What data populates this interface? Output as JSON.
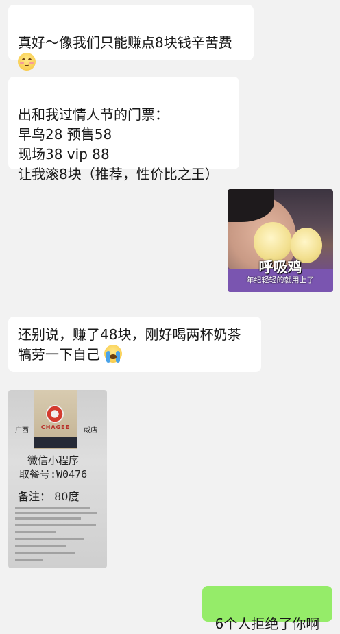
{
  "messages": [
    {
      "sender": "other",
      "type": "text",
      "text": "真好～像我们只能赚点8块钱辛苦费",
      "emoji": "smiling-face-icon"
    },
    {
      "sender": "other",
      "type": "text",
      "text": "出和我过情人节的门票：\n早鸟28  预售58\n现场38 vip 88\n让我滚8块（推荐，性价比之王）"
    },
    {
      "sender": "me",
      "type": "image",
      "meme_title": "呼吸鸡",
      "meme_subtitle": "年纪轻轻的就用上了"
    },
    {
      "sender": "other",
      "type": "text",
      "text_line1": "还别说，赚了48块，刚好喝两杯奶茶",
      "text_line2": "犒劳一下自己",
      "emoji": "crying-face-icon"
    },
    {
      "sender": "other",
      "type": "image",
      "receipt": {
        "brand": "CHAGEE",
        "store_left": "广西",
        "store_right": "威店",
        "channel": "微信小程序",
        "pickup_number": "取餐号:W0476",
        "note": "备注： 80度"
      }
    },
    {
      "sender": "me",
      "type": "text",
      "text": "6个人拒绝了你啊"
    }
  ],
  "colors": {
    "background": "#f2f2f2",
    "incoming_bubble": "#ffffff",
    "outgoing_bubble": "#95ec69"
  }
}
